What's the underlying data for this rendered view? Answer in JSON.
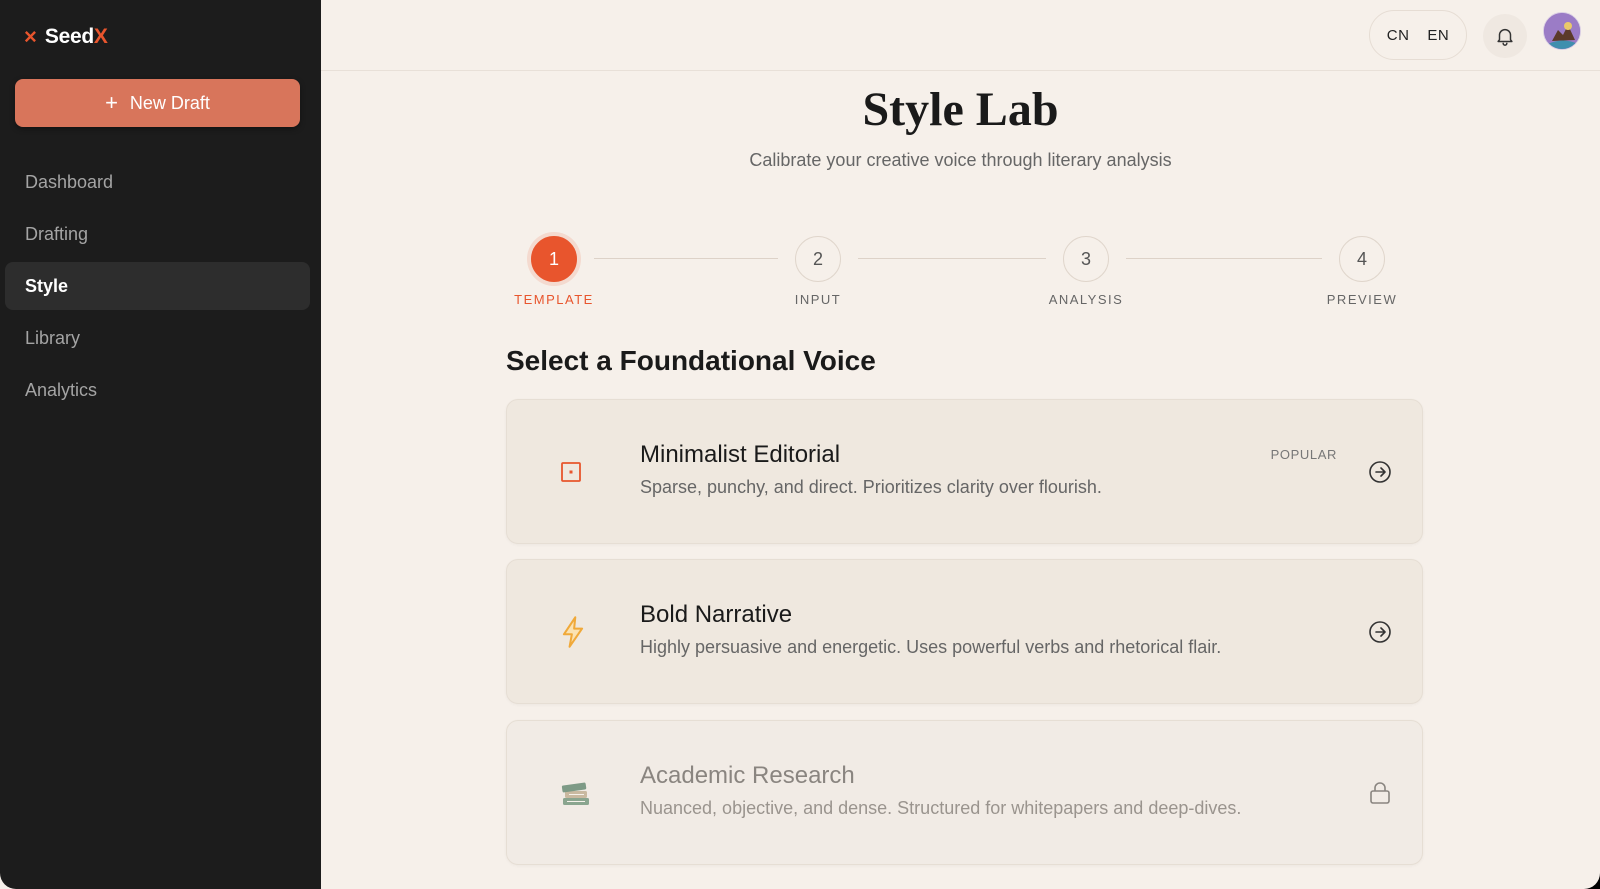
{
  "app": {
    "name_main": "Seed",
    "name_accent": "X",
    "logo_mark": "×"
  },
  "sidebar": {
    "new_draft_label": "New Draft",
    "items": [
      {
        "label": "Dashboard",
        "active": false
      },
      {
        "label": "Drafting",
        "active": false
      },
      {
        "label": "Style",
        "active": true
      },
      {
        "label": "Library",
        "active": false
      },
      {
        "label": "Analytics",
        "active": false
      }
    ]
  },
  "header": {
    "languages": [
      "CN",
      "EN"
    ],
    "icons": {
      "notifications": "bell-icon",
      "profile": "avatar"
    }
  },
  "page": {
    "title": "Style Lab",
    "subtitle": "Calibrate your creative voice through literary analysis"
  },
  "stepper": {
    "current_step": 1,
    "steps": [
      {
        "number": "1",
        "label": "TEMPLATE"
      },
      {
        "number": "2",
        "label": "INPUT"
      },
      {
        "number": "3",
        "label": "ANALYSIS"
      },
      {
        "number": "4",
        "label": "PREVIEW"
      }
    ]
  },
  "voices": {
    "heading": "Select a Foundational Voice",
    "cards": [
      {
        "title": "Minimalist Editorial",
        "description": "Sparse, punchy, and direct. Prioritizes clarity over flourish.",
        "badge": "POPULAR",
        "icon": "square-dot-icon",
        "locked": false
      },
      {
        "title": "Bold Narrative",
        "description": "Highly persuasive and energetic. Uses powerful verbs and rhetorical flair.",
        "badge": "",
        "icon": "lightning-icon",
        "locked": false
      },
      {
        "title": "Academic Research",
        "description": "Nuanced, objective, and dense. Structured for whitepapers and deep-dives.",
        "badge": "",
        "icon": "books-icon",
        "locked": true
      }
    ]
  },
  "colors": {
    "accent": "#e8552d",
    "button": "#d8755b",
    "sidebar": "#1c1c1c",
    "background": "#f6f0ea"
  }
}
